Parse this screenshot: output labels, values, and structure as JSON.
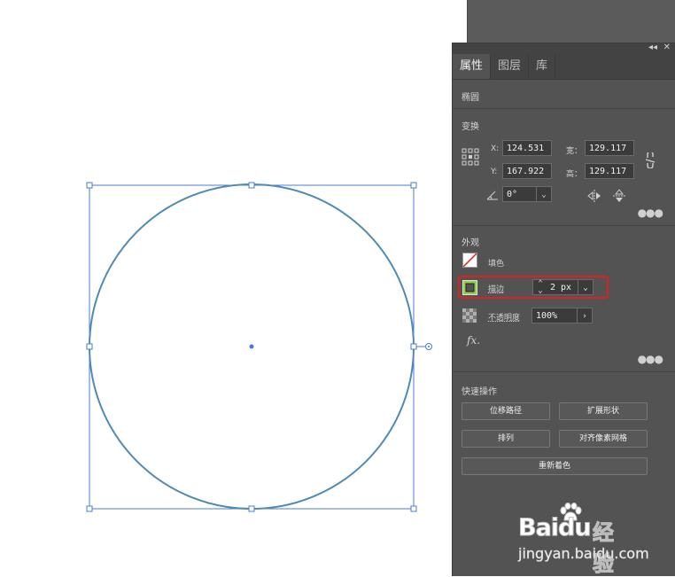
{
  "panel": {
    "tabs": [
      "属性",
      "图层",
      "库"
    ],
    "object_type": "椭圆",
    "collapse_icon": "double-chevron-left-icon",
    "close_icon": "close-icon"
  },
  "transform": {
    "title": "变换",
    "x_label": "X:",
    "x_value": "124.531",
    "y_label": "Y:",
    "y_value": "167.922",
    "w_label": "宽：",
    "w_value": "129.117",
    "h_label": "高：",
    "h_value": "129.117",
    "angle_value": "0°"
  },
  "appearance": {
    "title": "外观",
    "fill_label": "填色",
    "stroke_label": "描边",
    "stroke_value": "2 px",
    "opacity_label": "不透明度",
    "opacity_value": "100%",
    "fx_label": "fx."
  },
  "quick_actions": {
    "title": "快速操作",
    "offset_path": "位移路径",
    "expand_shape": "扩展形状",
    "arrange": "排列",
    "align_pixel_grid": "对齐像素网格",
    "recolor": "重新着色"
  },
  "watermark": {
    "brand": "Baidu",
    "brand_cn": "经验",
    "url": "jingyan.baidu.com"
  },
  "colors": {
    "circle_stroke": "#4f8bb2",
    "selection": "#4a7bd8",
    "highlight": "#e02020",
    "stroke_swatch": "#8cd24a"
  }
}
